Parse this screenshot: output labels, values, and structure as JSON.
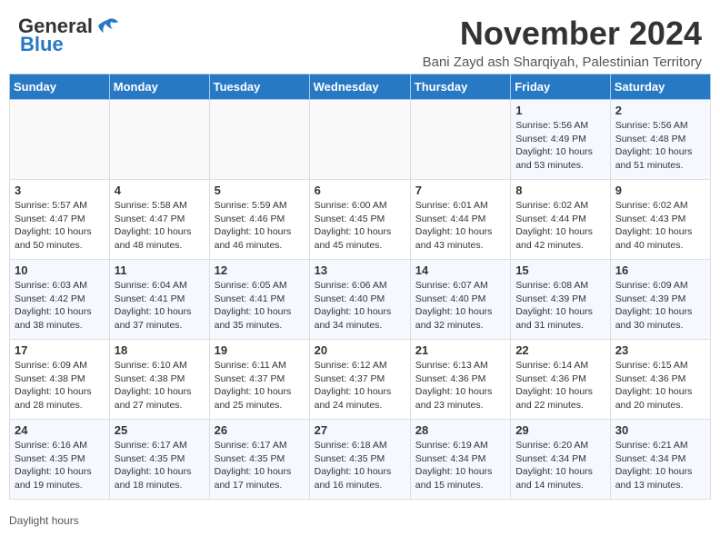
{
  "header": {
    "logo_line1": "General",
    "logo_line2": "Blue",
    "month_title": "November 2024",
    "subtitle": "Bani Zayd ash Sharqiyah, Palestinian Territory"
  },
  "calendar": {
    "days_of_week": [
      "Sunday",
      "Monday",
      "Tuesday",
      "Wednesday",
      "Thursday",
      "Friday",
      "Saturday"
    ],
    "weeks": [
      [
        {
          "day": "",
          "info": ""
        },
        {
          "day": "",
          "info": ""
        },
        {
          "day": "",
          "info": ""
        },
        {
          "day": "",
          "info": ""
        },
        {
          "day": "",
          "info": ""
        },
        {
          "day": "1",
          "info": "Sunrise: 5:56 AM\nSunset: 4:49 PM\nDaylight: 10 hours and 53 minutes."
        },
        {
          "day": "2",
          "info": "Sunrise: 5:56 AM\nSunset: 4:48 PM\nDaylight: 10 hours and 51 minutes."
        }
      ],
      [
        {
          "day": "3",
          "info": "Sunrise: 5:57 AM\nSunset: 4:47 PM\nDaylight: 10 hours and 50 minutes."
        },
        {
          "day": "4",
          "info": "Sunrise: 5:58 AM\nSunset: 4:47 PM\nDaylight: 10 hours and 48 minutes."
        },
        {
          "day": "5",
          "info": "Sunrise: 5:59 AM\nSunset: 4:46 PM\nDaylight: 10 hours and 46 minutes."
        },
        {
          "day": "6",
          "info": "Sunrise: 6:00 AM\nSunset: 4:45 PM\nDaylight: 10 hours and 45 minutes."
        },
        {
          "day": "7",
          "info": "Sunrise: 6:01 AM\nSunset: 4:44 PM\nDaylight: 10 hours and 43 minutes."
        },
        {
          "day": "8",
          "info": "Sunrise: 6:02 AM\nSunset: 4:44 PM\nDaylight: 10 hours and 42 minutes."
        },
        {
          "day": "9",
          "info": "Sunrise: 6:02 AM\nSunset: 4:43 PM\nDaylight: 10 hours and 40 minutes."
        }
      ],
      [
        {
          "day": "10",
          "info": "Sunrise: 6:03 AM\nSunset: 4:42 PM\nDaylight: 10 hours and 38 minutes."
        },
        {
          "day": "11",
          "info": "Sunrise: 6:04 AM\nSunset: 4:41 PM\nDaylight: 10 hours and 37 minutes."
        },
        {
          "day": "12",
          "info": "Sunrise: 6:05 AM\nSunset: 4:41 PM\nDaylight: 10 hours and 35 minutes."
        },
        {
          "day": "13",
          "info": "Sunrise: 6:06 AM\nSunset: 4:40 PM\nDaylight: 10 hours and 34 minutes."
        },
        {
          "day": "14",
          "info": "Sunrise: 6:07 AM\nSunset: 4:40 PM\nDaylight: 10 hours and 32 minutes."
        },
        {
          "day": "15",
          "info": "Sunrise: 6:08 AM\nSunset: 4:39 PM\nDaylight: 10 hours and 31 minutes."
        },
        {
          "day": "16",
          "info": "Sunrise: 6:09 AM\nSunset: 4:39 PM\nDaylight: 10 hours and 30 minutes."
        }
      ],
      [
        {
          "day": "17",
          "info": "Sunrise: 6:09 AM\nSunset: 4:38 PM\nDaylight: 10 hours and 28 minutes."
        },
        {
          "day": "18",
          "info": "Sunrise: 6:10 AM\nSunset: 4:38 PM\nDaylight: 10 hours and 27 minutes."
        },
        {
          "day": "19",
          "info": "Sunrise: 6:11 AM\nSunset: 4:37 PM\nDaylight: 10 hours and 25 minutes."
        },
        {
          "day": "20",
          "info": "Sunrise: 6:12 AM\nSunset: 4:37 PM\nDaylight: 10 hours and 24 minutes."
        },
        {
          "day": "21",
          "info": "Sunrise: 6:13 AM\nSunset: 4:36 PM\nDaylight: 10 hours and 23 minutes."
        },
        {
          "day": "22",
          "info": "Sunrise: 6:14 AM\nSunset: 4:36 PM\nDaylight: 10 hours and 22 minutes."
        },
        {
          "day": "23",
          "info": "Sunrise: 6:15 AM\nSunset: 4:36 PM\nDaylight: 10 hours and 20 minutes."
        }
      ],
      [
        {
          "day": "24",
          "info": "Sunrise: 6:16 AM\nSunset: 4:35 PM\nDaylight: 10 hours and 19 minutes."
        },
        {
          "day": "25",
          "info": "Sunrise: 6:17 AM\nSunset: 4:35 PM\nDaylight: 10 hours and 18 minutes."
        },
        {
          "day": "26",
          "info": "Sunrise: 6:17 AM\nSunset: 4:35 PM\nDaylight: 10 hours and 17 minutes."
        },
        {
          "day": "27",
          "info": "Sunrise: 6:18 AM\nSunset: 4:35 PM\nDaylight: 10 hours and 16 minutes."
        },
        {
          "day": "28",
          "info": "Sunrise: 6:19 AM\nSunset: 4:34 PM\nDaylight: 10 hours and 15 minutes."
        },
        {
          "day": "29",
          "info": "Sunrise: 6:20 AM\nSunset: 4:34 PM\nDaylight: 10 hours and 14 minutes."
        },
        {
          "day": "30",
          "info": "Sunrise: 6:21 AM\nSunset: 4:34 PM\nDaylight: 10 hours and 13 minutes."
        }
      ]
    ]
  },
  "footer": {
    "daylight_hours_label": "Daylight hours"
  }
}
